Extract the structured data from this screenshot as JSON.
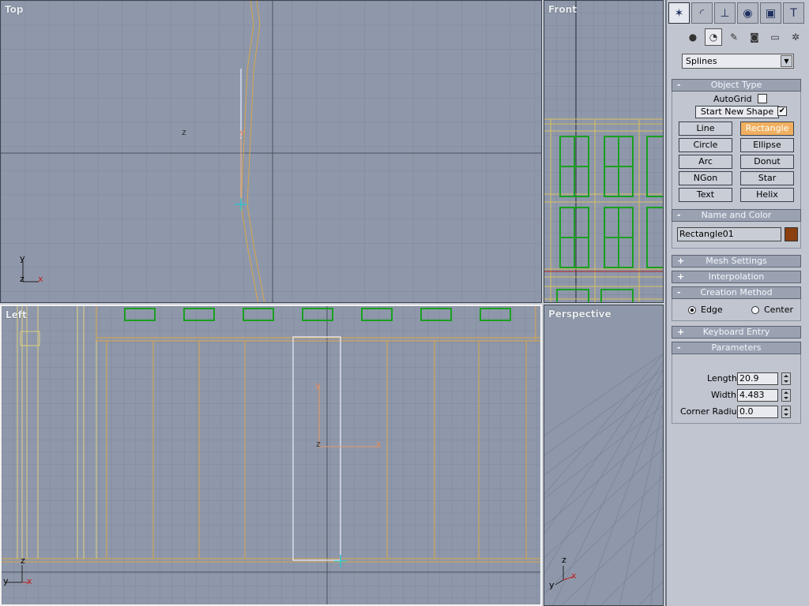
{
  "viewports": {
    "top": {
      "label": "Top",
      "axis_z": "z",
      "axis_y": "y",
      "gizmo": {
        "y": "y",
        "z": "z",
        "x": "x"
      }
    },
    "front": {
      "label": "Front"
    },
    "left": {
      "label": "Left",
      "axis_y": "y",
      "axis_z": "z",
      "axis_x": "x",
      "gizmo": {
        "z": "z",
        "y": "y",
        "x": "x"
      }
    },
    "perspective": {
      "label": "Perspective",
      "gizmo": {
        "z": "z",
        "y": "y",
        "x": "x"
      }
    }
  },
  "command_panel": {
    "tabs": [
      {
        "icon": "create-icon",
        "glyph": "✶"
      },
      {
        "icon": "modify-icon",
        "glyph": "◜"
      },
      {
        "icon": "hierarchy-icon",
        "glyph": "⊥"
      },
      {
        "icon": "motion-icon",
        "glyph": "◉"
      },
      {
        "icon": "display-icon",
        "glyph": "▣"
      },
      {
        "icon": "utilities-icon",
        "glyph": "T"
      }
    ],
    "sub_icons": [
      {
        "icon": "geometry-icon",
        "glyph": "●"
      },
      {
        "icon": "shapes-icon",
        "glyph": "◔"
      },
      {
        "icon": "lights-icon",
        "glyph": "✎"
      },
      {
        "icon": "cameras-icon",
        "glyph": "◙"
      },
      {
        "icon": "helpers-icon",
        "glyph": "▭"
      },
      {
        "icon": "spacewarps-icon",
        "glyph": "✲"
      }
    ],
    "category_dropdown": "Splines",
    "object_type": {
      "title": "Object Type",
      "collapse": "-",
      "autogrid_label": "AutoGrid",
      "start_new_shape_label": "Start New Shape",
      "start_new_shape_checked": "✔",
      "buttons": [
        "Line",
        "Rectangle",
        "Circle",
        "Ellipse",
        "Arc",
        "Donut",
        "NGon",
        "Star",
        "Text",
        "Helix"
      ],
      "active": "Rectangle"
    },
    "name_and_color": {
      "title": "Name and Color",
      "collapse": "-",
      "name_value": "Rectangle01",
      "color": "#8b3f0e"
    },
    "mesh_settings": {
      "title": "Mesh Settings",
      "expand": "+"
    },
    "interpolation": {
      "title": "Interpolation",
      "expand": "+"
    },
    "creation_method": {
      "title": "Creation Method",
      "collapse": "-",
      "edge_label": "Edge",
      "center_label": "Center",
      "selected": "Edge"
    },
    "keyboard_entry": {
      "title": "Keyboard Entry",
      "expand": "+"
    },
    "parameters": {
      "title": "Parameters",
      "collapse": "-",
      "length_label": "Length:",
      "length_value": "20.9",
      "width_label": "Width:",
      "width_value": "4.483",
      "corner_radius_label": "Corner Radius:",
      "corner_radius_value": "0.0"
    }
  }
}
